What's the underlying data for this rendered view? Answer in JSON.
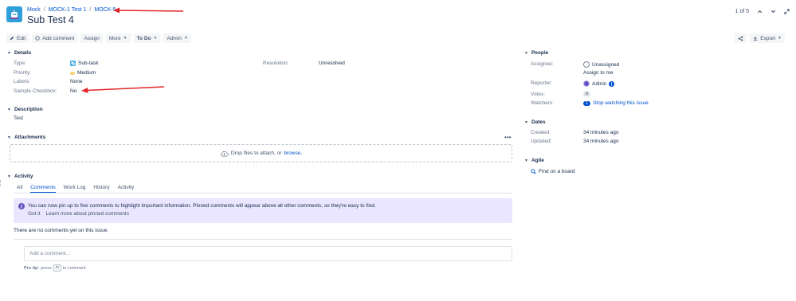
{
  "breadcrumb": {
    "project": "Mock",
    "parent": "MOCK-1 Test 1",
    "issue_key": "MOCK-5",
    "separator": "/"
  },
  "issue": {
    "title": "Sub Test 4"
  },
  "pager": {
    "text": "1 of 5"
  },
  "toolbar": {
    "edit": "Edit",
    "add_comment": "Add comment",
    "assign": "Assign",
    "more": "More",
    "todo": "To Do",
    "admin": "Admin",
    "export": "Export"
  },
  "details": {
    "heading": "Details",
    "type_label": "Type:",
    "type_value": "Sub-task",
    "priority_label": "Priority:",
    "priority_value": "Medium",
    "labels_label": "Labels:",
    "labels_value": "None",
    "checkbox_label": "Sample Checkbox:",
    "checkbox_value": "No",
    "resolution_label": "Resolution:",
    "resolution_value": "Unresolved"
  },
  "description": {
    "heading": "Description",
    "text": "Test"
  },
  "attachments": {
    "heading": "Attachments",
    "drop_text": "Drop files to attach, or",
    "browse": "browse."
  },
  "activity": {
    "heading": "Activity",
    "tabs": [
      "All",
      "Comments",
      "Work Log",
      "History",
      "Activity"
    ],
    "active_tab": "Comments",
    "info_text": "You can now pin up to five comments to highlight important information. Pinned comments will appear above all other comments, so they're easy to find.",
    "got_it": "Got it",
    "learn_more": "Learn more about pinned comments",
    "no_comments": "There are no comments yet on this issue.",
    "comment_placeholder": "Add a comment...",
    "pro_tip_label": "Pro tip:",
    "pro_tip_press": "press",
    "pro_tip_key": "m",
    "pro_tip_suffix": "to comment"
  },
  "people": {
    "heading": "People",
    "assignee_label": "Assignee:",
    "assignee_value": "Unassigned",
    "assign_to_me": "Assign to me",
    "reporter_label": "Reporter:",
    "reporter_value": "Admin",
    "votes_label": "Votes:",
    "votes_value": "0",
    "watchers_label": "Watchers:",
    "watchers_count": "1",
    "watchers_link": "Stop watching this issue"
  },
  "dates": {
    "heading": "Dates",
    "created_label": "Created:",
    "created_value": "34 minutes ago",
    "updated_label": "Updated:",
    "updated_value": "34 minutes ago"
  },
  "agile": {
    "heading": "Agile",
    "find_on_board": "Find on a board"
  },
  "colors": {
    "link": "#0052cc",
    "annotation_arrow": "#e3262a",
    "info_bg": "#eae6ff",
    "project_avatar": "#2f9fd7"
  },
  "icons": {
    "project": "project-avatar-icon",
    "subtask": "subtask-icon",
    "priority": "priority-medium-icon",
    "cloud": "cloud-upload-icon",
    "info": "info-icon",
    "share": "share-icon",
    "search": "search-icon"
  }
}
